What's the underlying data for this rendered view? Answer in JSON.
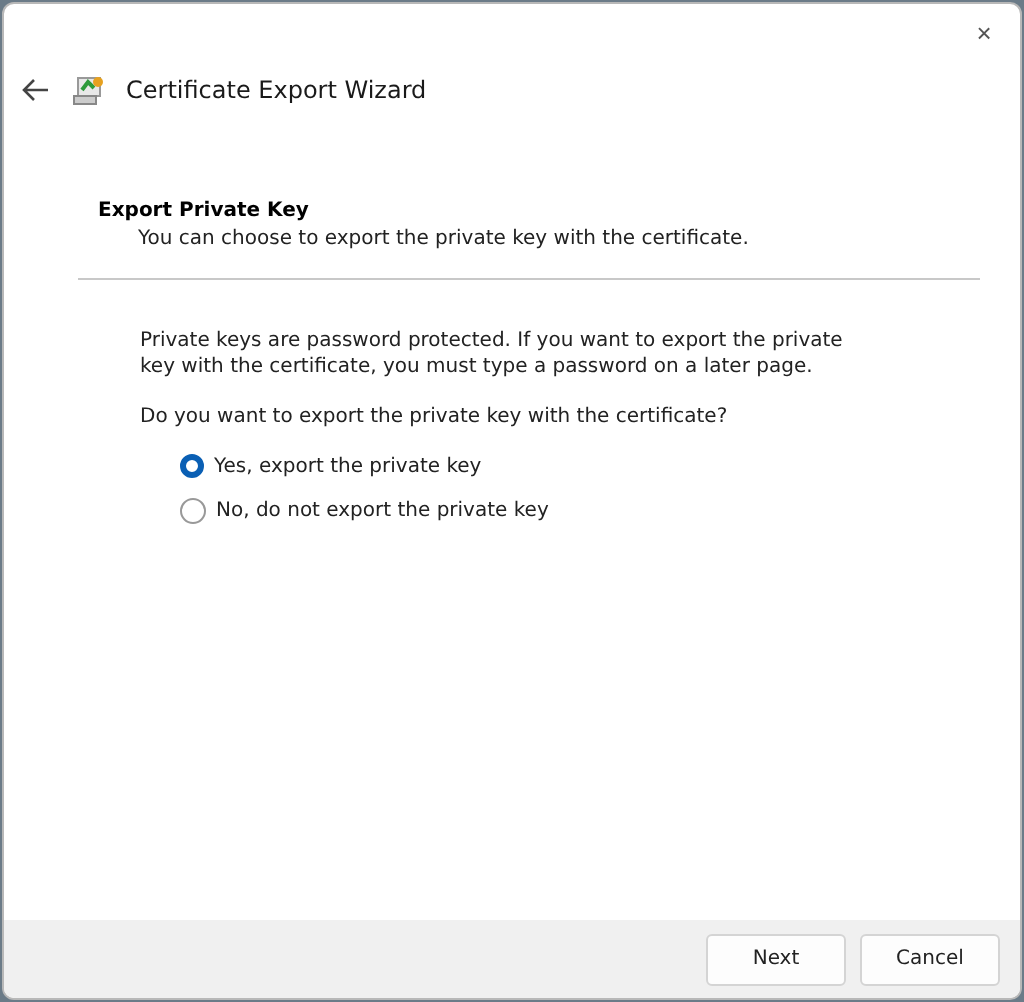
{
  "window": {
    "title": "Certificate Export Wizard",
    "close_label": "×"
  },
  "header": {
    "title": "Export Private Key",
    "subtitle": "You can choose to export the private key with the certificate."
  },
  "body": {
    "info": "Private keys are password protected. If you want to export the private key with the certificate, you must type a password on a later page.",
    "question": "Do you want to export the private key with the certificate?"
  },
  "options": [
    {
      "label": "Yes, export the private key",
      "selected": true
    },
    {
      "label": "No, do not export the private key",
      "selected": false
    }
  ],
  "buttons": [
    {
      "label": "Next"
    },
    {
      "label": "Cancel"
    }
  ]
}
